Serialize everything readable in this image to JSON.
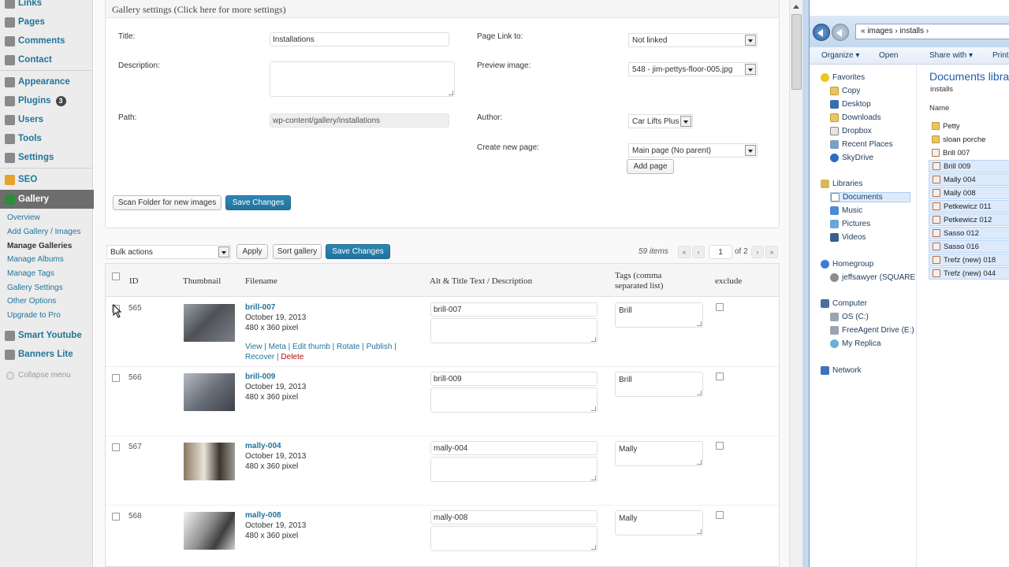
{
  "sidebar": {
    "items": [
      {
        "label": "Links",
        "icon": "links-icon",
        "color": "#7a7a7a"
      },
      {
        "label": "Pages",
        "icon": "pages-icon",
        "color": "#7a7a7a"
      },
      {
        "label": "Comments",
        "icon": "comments-icon",
        "color": "#7a7a7a"
      },
      {
        "label": "Contact",
        "icon": "contact-icon",
        "color": "#7a7a7a"
      },
      {
        "label": "Appearance",
        "icon": "appearance-icon",
        "color": "#7a7a7a"
      },
      {
        "label": "Plugins",
        "icon": "plugins-icon",
        "color": "#7a7a7a",
        "badge": "3"
      },
      {
        "label": "Users",
        "icon": "users-icon",
        "color": "#7a7a7a"
      },
      {
        "label": "Tools",
        "icon": "tools-icon",
        "color": "#7a7a7a"
      },
      {
        "label": "Settings",
        "icon": "settings-icon",
        "color": "#7a7a7a"
      },
      {
        "label": "SEO",
        "icon": "seo-icon",
        "color": "#e6a22b"
      },
      {
        "label": "Gallery",
        "icon": "gallery-icon",
        "color": "#2a8f3b"
      },
      {
        "label": "Smart Youtube",
        "icon": "youtube-icon",
        "color": "#7a7a7a"
      },
      {
        "label": "Banners Lite",
        "icon": "banners-icon",
        "color": "#7a7a7a"
      }
    ],
    "gallery_submenu": [
      "Overview",
      "Add Gallery / Images",
      "Manage Galleries",
      "Manage Albums",
      "Manage Tags",
      "Gallery Settings",
      "Other Options",
      "Upgrade to Pro"
    ],
    "collapse_label": "Collapse menu"
  },
  "settings": {
    "title": "Gallery settings",
    "title_hint": "(Click here for more settings)",
    "title_label": "Title:",
    "title_value": "Installations",
    "description_label": "Description:",
    "description_value": "",
    "path_label": "Path:",
    "path_value": "wp-content/gallery/installations",
    "page_link_label": "Page Link to:",
    "page_link_value": "Not linked",
    "preview_label": "Preview image:",
    "preview_value": "548 - jim-pettys-floor-005.jpg",
    "author_label": "Author:",
    "author_value": "Car Lifts Plus",
    "new_page_label": "Create new page:",
    "new_page_value": "Main page (No parent)",
    "add_page_button": "Add page",
    "scan_button": "Scan Folder for new images",
    "save_button": "Save Changes"
  },
  "toolbar": {
    "bulk_value": "Bulk actions",
    "apply_button": "Apply",
    "sort_button": "Sort gallery",
    "save_button": "Save Changes",
    "items_count": "59 items",
    "page_current": "1",
    "page_total": "of 2"
  },
  "table": {
    "headers": {
      "id": "ID",
      "thumbnail": "Thumbnail",
      "filename": "Filename",
      "alt": "Alt & Title Text / Description",
      "tags": "Tags (comma separated list)",
      "exclude": "exclude"
    },
    "rows": [
      {
        "id": "565",
        "filename": "brill-007",
        "date": "October 19, 2013",
        "size": "480 x 360 pixel",
        "alt": "brill-007",
        "tags": "Brill",
        "thumb_color": "#6b6e73"
      },
      {
        "id": "566",
        "filename": "brill-009",
        "date": "October 19, 2013",
        "size": "480 x 360 pixel",
        "alt": "brill-009",
        "tags": "Brill",
        "thumb_color": "#8a8f98"
      },
      {
        "id": "567",
        "filename": "mally-004",
        "date": "October 19, 2013",
        "size": "480 x 360 pixel",
        "alt": "mally-004",
        "tags": "Mally",
        "thumb_color": "#7c6a55"
      },
      {
        "id": "568",
        "filename": "mally-008",
        "date": "October 19, 2013",
        "size": "480 x 360 pixel",
        "alt": "mally-008",
        "tags": "Mally",
        "thumb_color": "#9a9a9a"
      }
    ],
    "row_actions": {
      "view": "View",
      "meta": "Meta",
      "edit_thumb": "Edit thumb",
      "rotate": "Rotate",
      "publish": "Publish",
      "recover": "Recover",
      "delete": "Delete"
    }
  },
  "explorer": {
    "address": "« images › installs ›",
    "commands": [
      "Organize ▾",
      "Open",
      "Share with ▾",
      "Print"
    ],
    "nav": {
      "favorites": "Favorites",
      "favorites_items": [
        "Copy",
        "Desktop",
        "Downloads",
        "Dropbox",
        "Recent Places",
        "SkyDrive"
      ],
      "libraries": "Libraries",
      "libraries_items": [
        "Documents",
        "Music",
        "Pictures",
        "Videos"
      ],
      "homegroup": "Homegroup",
      "homegroup_items": [
        "jeffsawyer (SQUARE"
      ],
      "computer": "Computer",
      "computer_items": [
        "OS (C:)",
        "FreeAgent Drive (E:)",
        "My Replica"
      ],
      "network": "Network"
    },
    "library_title": "Documents libra",
    "library_subtitle": "installs",
    "column_name": "Name",
    "files": [
      {
        "name": "Petty",
        "type": "folder"
      },
      {
        "name": "sloan porche",
        "type": "folder"
      },
      {
        "name": "Brill 007",
        "type": "file"
      },
      {
        "name": "Brill 009",
        "type": "file"
      },
      {
        "name": "Mally 004",
        "type": "file"
      },
      {
        "name": "Mally 008",
        "type": "file"
      },
      {
        "name": "Petkewicz 011",
        "type": "file"
      },
      {
        "name": "Petkewicz 012",
        "type": "file"
      },
      {
        "name": "Sasso 012",
        "type": "file"
      },
      {
        "name": "Sasso 016",
        "type": "file"
      },
      {
        "name": "Trefz (new) 018",
        "type": "file"
      },
      {
        "name": "Trefz (new) 044",
        "type": "file"
      }
    ]
  },
  "colors": {
    "link": "#21759b",
    "primary_button": "#21759b",
    "delete": "#bc0b0b",
    "sidebar_active": "#6d6d6d"
  }
}
